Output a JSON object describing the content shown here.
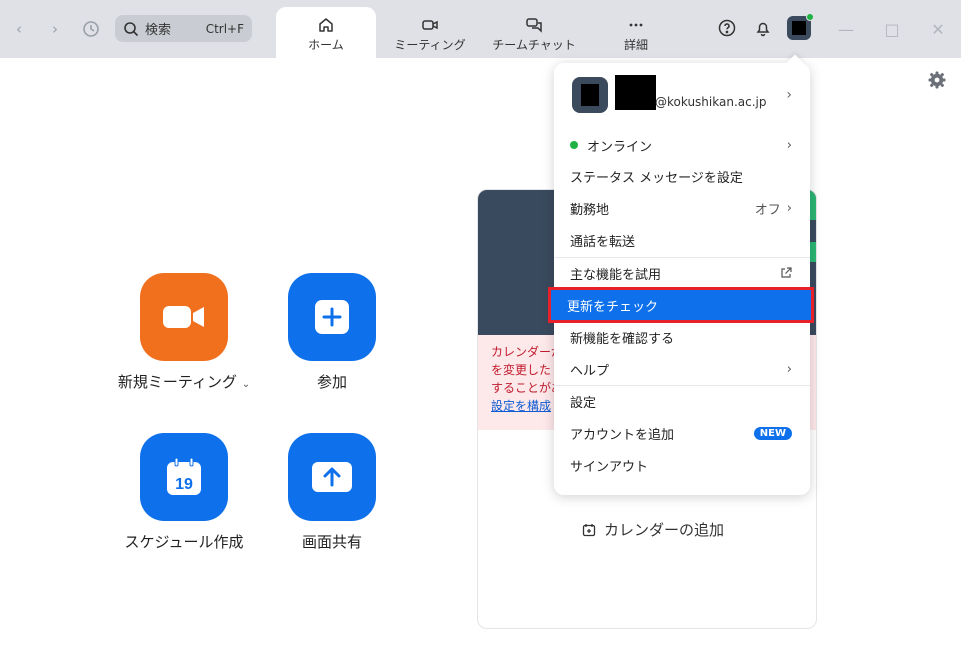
{
  "nav": {
    "search_label": "検索",
    "search_shortcut": "Ctrl+F",
    "tabs": [
      {
        "label": "ホーム",
        "icon": "home-icon",
        "active": true
      },
      {
        "label": "ミーティング",
        "icon": "video-icon",
        "active": false
      },
      {
        "label": "チームチャット",
        "icon": "chat-icon",
        "active": false
      },
      {
        "label": "詳細",
        "icon": "more-icon",
        "active": false
      }
    ]
  },
  "actions": [
    {
      "label": "新規ミーティング",
      "color": "#f0701e",
      "icon": "video-camera-icon"
    },
    {
      "label": "参加",
      "color": "#0e71eb",
      "icon": "plus-icon"
    },
    {
      "label": "スケジュール作成",
      "color": "#0e71eb",
      "icon": "calendar-icon",
      "icon_text": "19"
    },
    {
      "label": "画面共有",
      "color": "#0e71eb",
      "icon": "share-up-arrow-icon"
    }
  ],
  "calendar": {
    "warning_lines": [
      "カレンダーが",
      "を変更した",
      "することがあ"
    ],
    "settings_link": "設定を構成",
    "add_calendar": "カレンダーの追加"
  },
  "profile_menu": {
    "email": "@kokushikan.ac.jp",
    "items": [
      {
        "label": "オンライン",
        "right": "",
        "chevron": true
      },
      {
        "label": "ステータス メッセージを設定",
        "right": "",
        "chevron": false
      },
      {
        "label": "勤務地",
        "right": "オフ",
        "chevron": true
      },
      {
        "label": "通話を転送",
        "right": "",
        "chevron": false
      },
      {
        "label": "主な機能を試用",
        "right": "",
        "chevron": false
      },
      {
        "label": "更新をチェック",
        "right": "",
        "chevron": false,
        "highlighted": true
      },
      {
        "label": "新機能を確認する",
        "right": "",
        "chevron": false
      },
      {
        "label": "ヘルプ",
        "right": "",
        "chevron": true
      },
      {
        "label": "設定",
        "right": "",
        "chevron": false
      },
      {
        "label": "アカウントを追加",
        "right": "",
        "badge": "NEW"
      },
      {
        "label": "サインアウト",
        "right": "",
        "chevron": false
      }
    ]
  },
  "colors": {
    "accent": "#0e71eb",
    "orange": "#f0701e",
    "online": "#1fb141",
    "highlight_border": "#e8202a"
  }
}
